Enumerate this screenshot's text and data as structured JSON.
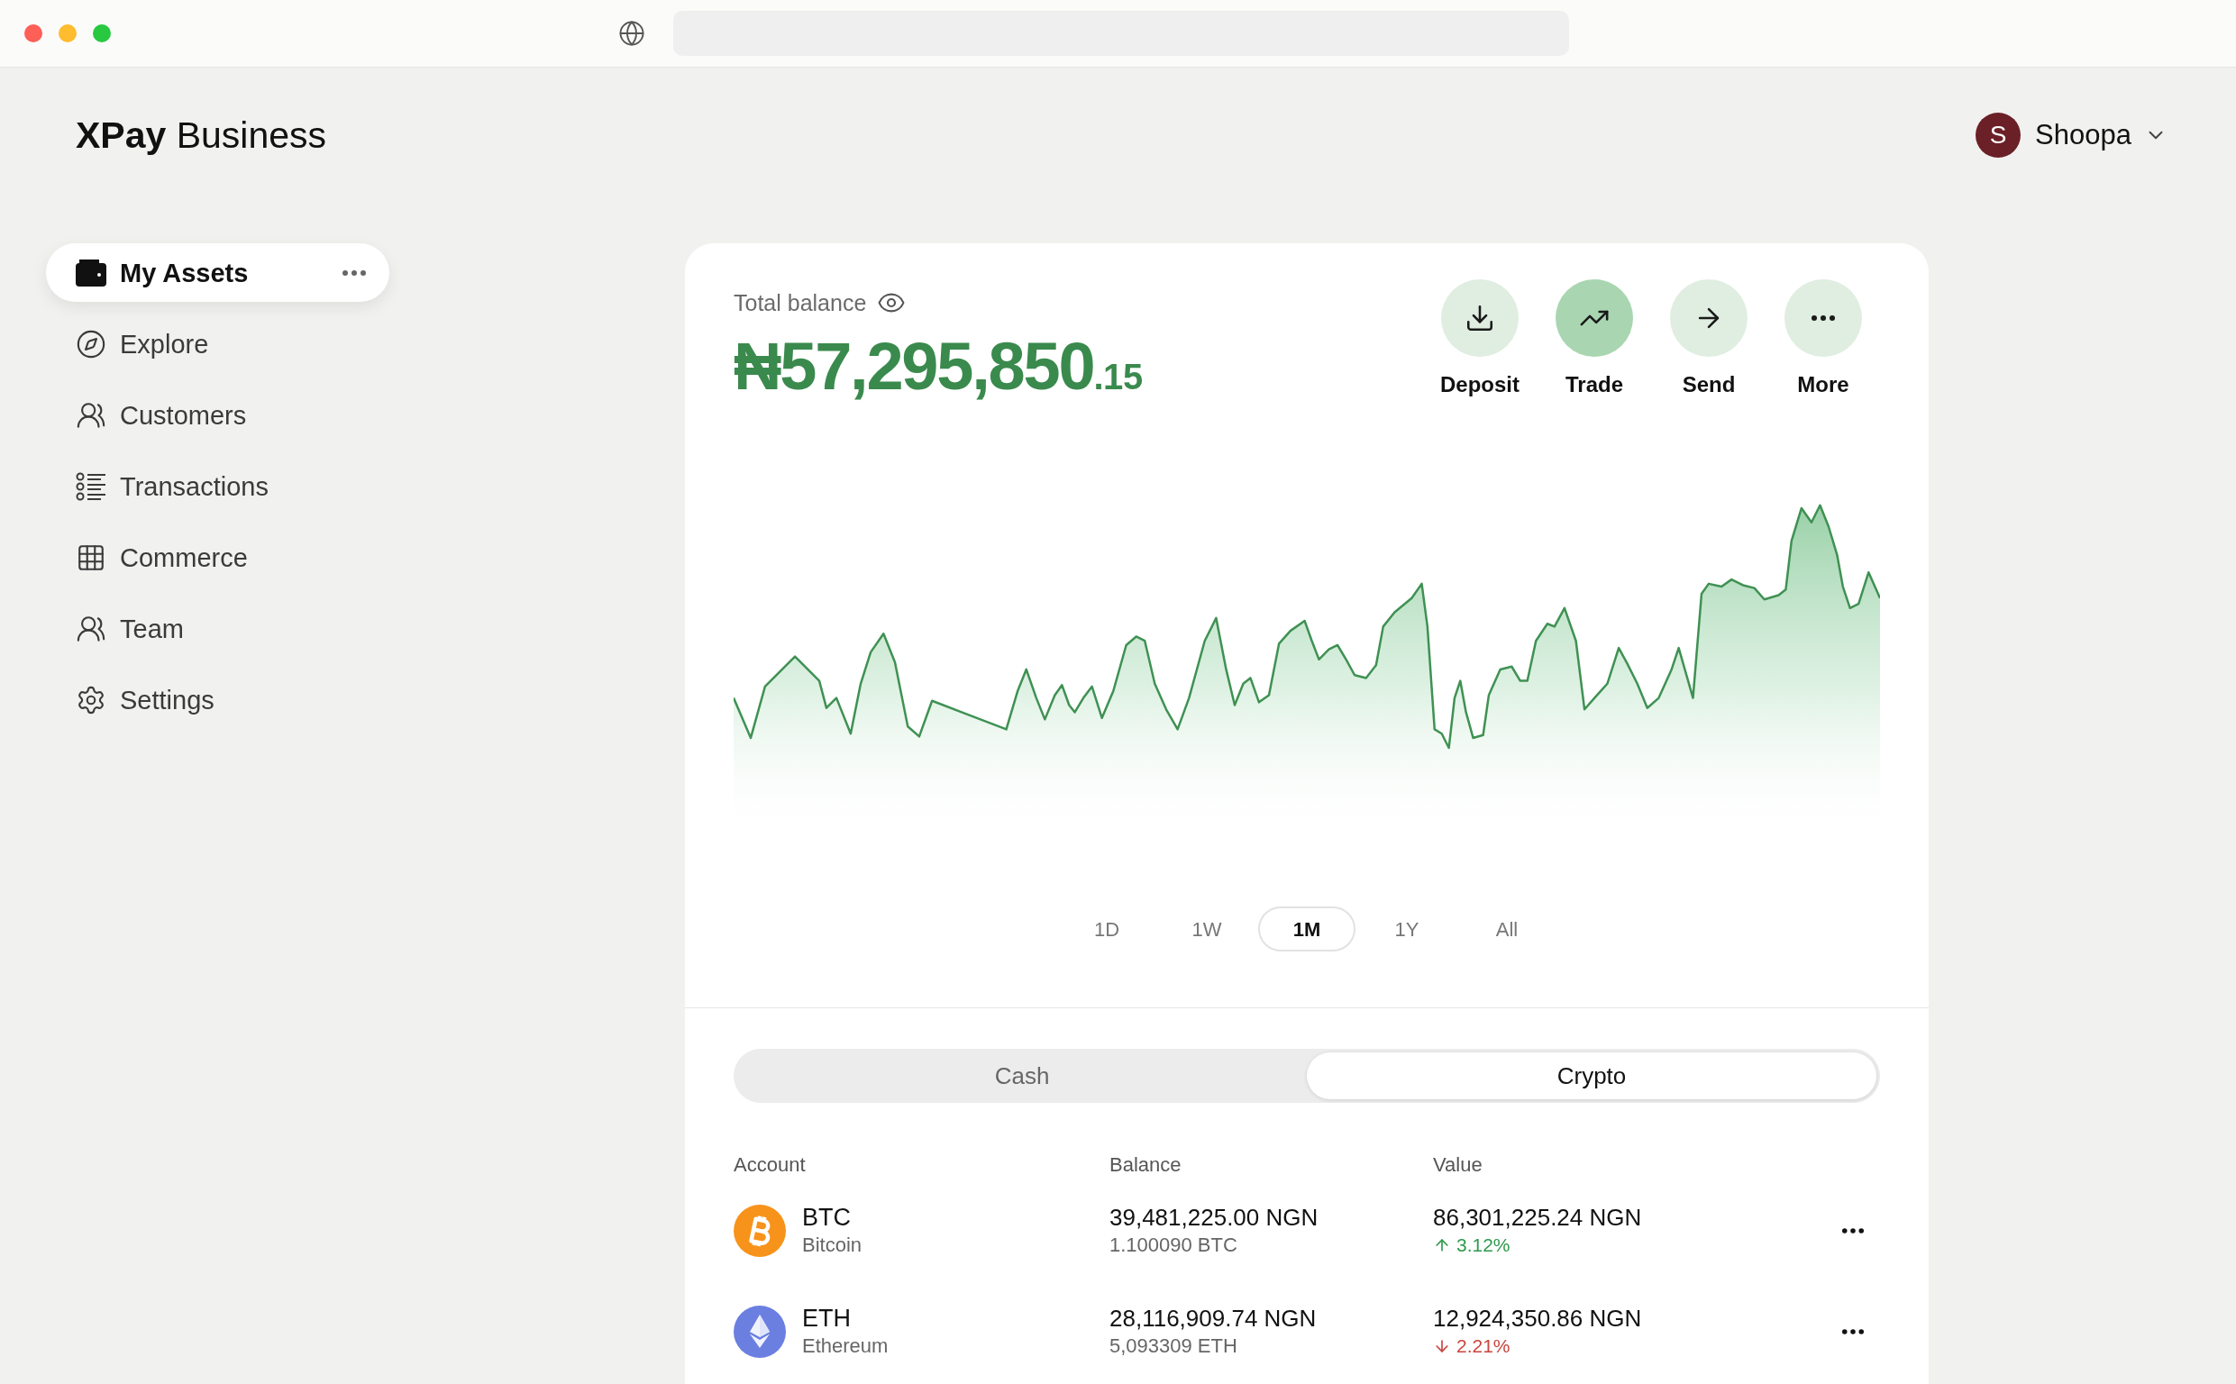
{
  "brand": {
    "title": "**XPay** Business"
  },
  "user": {
    "initial": "S",
    "name": "Shoopa"
  },
  "sidebar": {
    "items": [
      {
        "label": "My Assets",
        "selected": true
      },
      {
        "label": "Explore",
        "selected": false
      },
      {
        "label": "Customers",
        "selected": false
      },
      {
        "label": "Transactions",
        "selected": false
      },
      {
        "label": "Commerce",
        "selected": false
      },
      {
        "label": "Team",
        "selected": false
      },
      {
        "label": "Settings",
        "selected": false
      }
    ]
  },
  "balance": {
    "label": "Total balance",
    "amount": "₦57,295,850",
    "fraction": ".15"
  },
  "actions": [
    {
      "label": "Deposit",
      "selected": false
    },
    {
      "label": "Trade",
      "selected": true
    },
    {
      "label": "Send",
      "selected": false
    },
    {
      "label": "More",
      "selected": false
    }
  ],
  "periods": [
    {
      "label": "1D",
      "selected": false
    },
    {
      "label": "1W",
      "selected": false
    },
    {
      "label": "1M",
      "selected": true
    },
    {
      "label": "1Y",
      "selected": false
    },
    {
      "label": "All",
      "selected": false
    }
  ],
  "tabs": [
    {
      "label": "Cash",
      "selected": false
    },
    {
      "label": "Crypto",
      "selected": true
    }
  ],
  "table": {
    "columns": [
      "Account",
      "Balance",
      "Value"
    ],
    "rows": [
      {
        "symbol": "BTC",
        "name": "Bitcoin",
        "balance": "39,481,225.00 NGN",
        "balance_units": "1.100090 BTC",
        "value": "86,301,225.24 NGN",
        "change": "3.12%",
        "rising": true
      },
      {
        "symbol": "ETH",
        "name": "Ethereum",
        "balance": "28,116,909.74 NGN",
        "balance_units": "5,093309 ETH",
        "value": "12,924,350.86 NGN",
        "change": "2.21%",
        "rising": false
      }
    ]
  }
}
